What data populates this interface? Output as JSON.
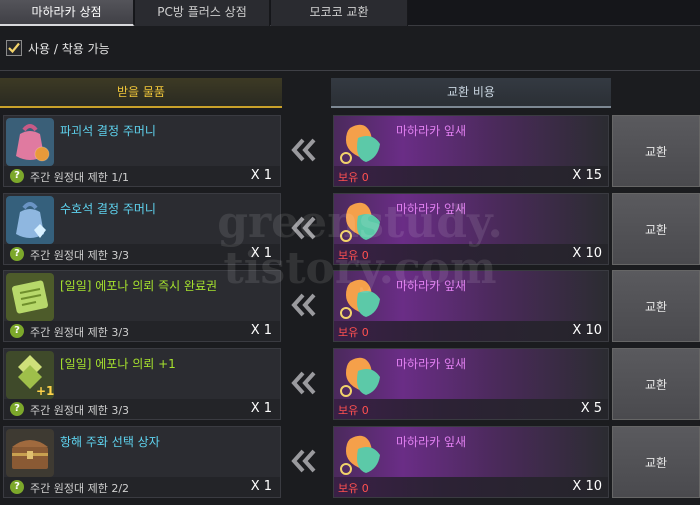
{
  "tabs": [
    {
      "label": "마하라카 상점",
      "active": true
    },
    {
      "label": "PC방 플러스 상점",
      "active": false
    },
    {
      "label": "모코코 교환",
      "active": false
    }
  ],
  "filter": {
    "label": "사용 / 착용 가능",
    "checked": true
  },
  "columns": {
    "receive": "받을 물품",
    "cost": "교환 비용"
  },
  "colors": {
    "gold": "#f0c63a",
    "cyan_item": "#5fd4f0",
    "green_item": "#a6e22e",
    "purple_currency": "#e07ff0",
    "owned_red": "#ff5050"
  },
  "rows": [
    {
      "item_name": "파괴석 결정 주머니",
      "item_color": "#5fd4f0",
      "item_icon": "pouch-pink-icon",
      "limit": "주간 원정대 제한 1/1",
      "qty": "X 1",
      "currency": "마하라카 잎새",
      "owned": "보유 0",
      "cost": "X 15",
      "button": "교환"
    },
    {
      "item_name": "수호석 결정 주머니",
      "item_color": "#5fd4f0",
      "item_icon": "pouch-blue-icon",
      "limit": "주간 원정대 제한 3/3",
      "qty": "X 1",
      "currency": "마하라카 잎새",
      "owned": "보유 0",
      "cost": "X 10",
      "button": "교환"
    },
    {
      "item_name": "[일일] 에포나 의뢰 즉시 완료권",
      "item_color": "#a6e22e",
      "item_icon": "scroll-ticket-icon",
      "limit": "주간 원정대 제한 3/3",
      "qty": "X 1",
      "currency": "마하라카 잎새",
      "owned": "보유 0",
      "cost": "X 10",
      "button": "교환"
    },
    {
      "item_name": "[일일] 에포나 의뢰 +1",
      "item_color": "#a6e22e",
      "item_icon": "epona-plus-icon",
      "item_icon_badge": "+1",
      "limit": "주간 원정대 제한 3/3",
      "qty": "X 1",
      "currency": "마하라카 잎새",
      "owned": "보유 0",
      "cost": "X 5",
      "button": "교환"
    },
    {
      "item_name": "항해 주화 선택 상자",
      "item_color": "#5fd4f0",
      "item_icon": "treasure-chest-icon",
      "limit": "주간 원정대 제한 2/2",
      "qty": "X 1",
      "currency": "마하라카 잎새",
      "owned": "보유 0",
      "cost": "X 10",
      "button": "교환"
    }
  ],
  "watermark": {
    "line1": "greenstudy.",
    "line2": "tistory.com"
  }
}
